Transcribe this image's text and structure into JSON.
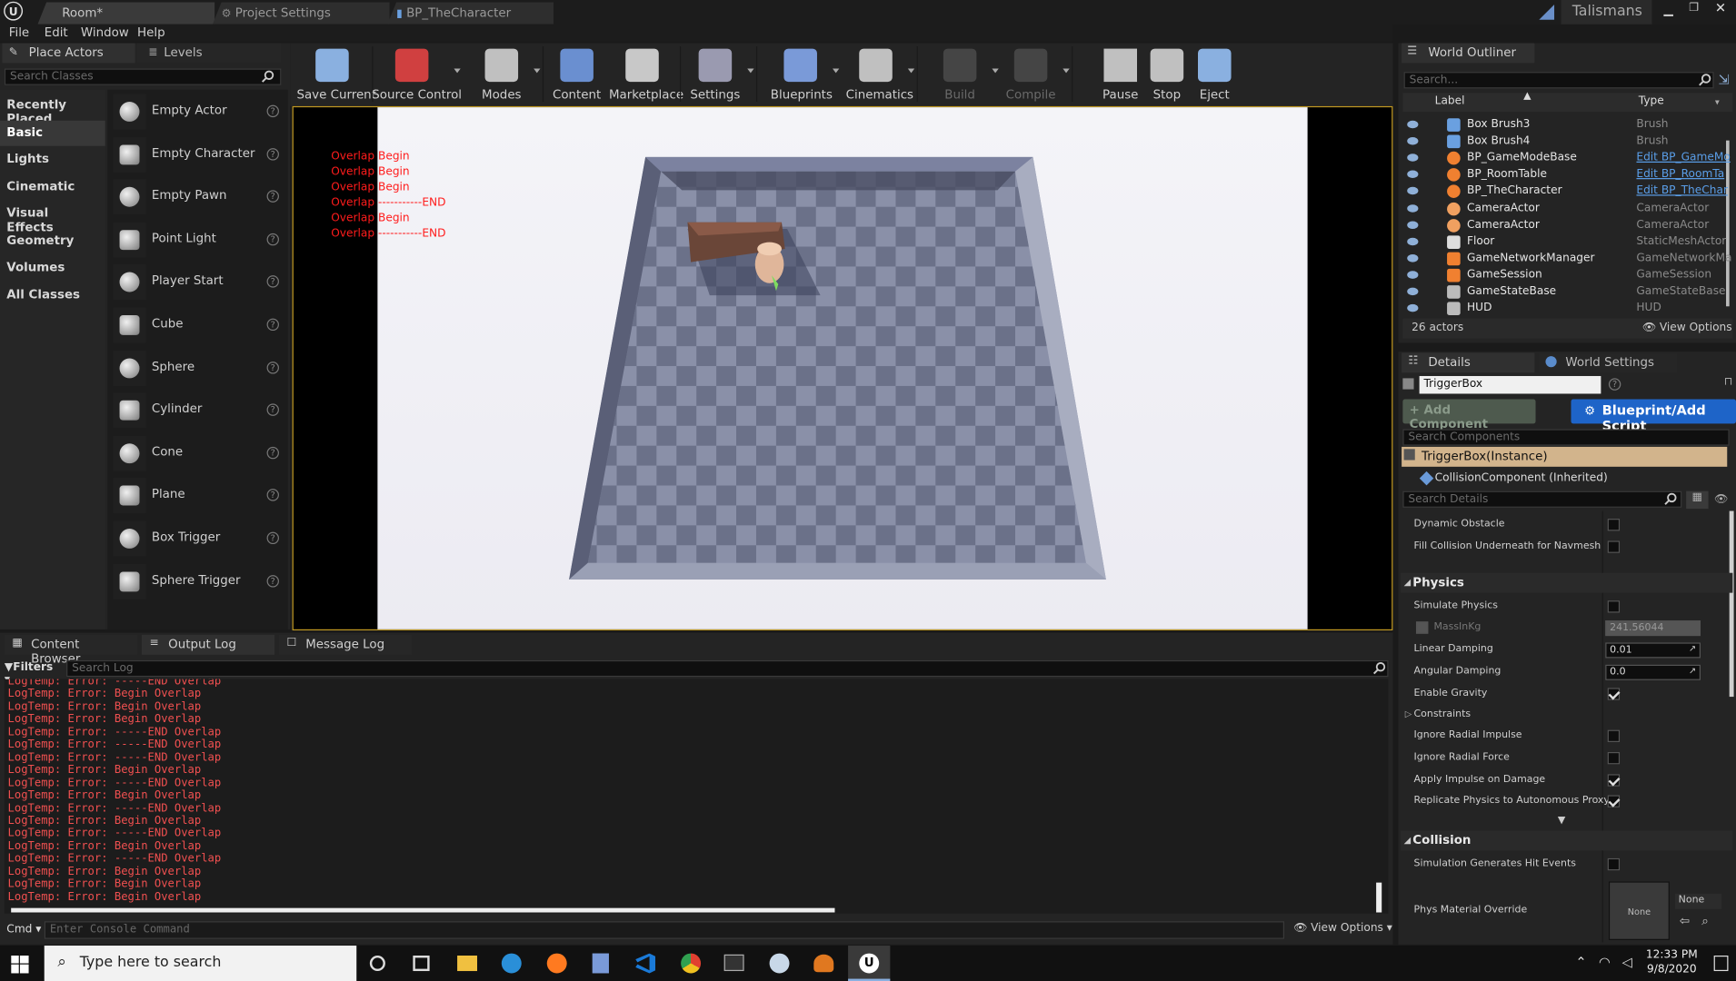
{
  "title_bar": {
    "tabs": [
      "Room*",
      "Project Settings",
      "BP_TheCharacter"
    ],
    "project_name": "Talismans"
  },
  "menu": [
    "File",
    "Edit",
    "Window",
    "Help"
  ],
  "place_actors": {
    "tab_label": "Place Actors",
    "levels_tab": "Levels",
    "search_placeholder": "Search Classes",
    "categories": [
      "Recently Placed",
      "Basic",
      "Lights",
      "Cinematic",
      "Visual Effects",
      "Geometry",
      "Volumes",
      "All Classes"
    ],
    "selected_category": "Basic",
    "actors": [
      "Empty Actor",
      "Empty Character",
      "Empty Pawn",
      "Point Light",
      "Player Start",
      "Cube",
      "Sphere",
      "Cylinder",
      "Cone",
      "Plane",
      "Box Trigger",
      "Sphere Trigger"
    ]
  },
  "toolbar": [
    "Save Current",
    "Source Control",
    "Modes",
    "Content",
    "Marketplace",
    "Settings",
    "Blueprints",
    "Cinematics",
    "Build",
    "Compile",
    "Pause",
    "Stop",
    "Eject"
  ],
  "viewport": {
    "overlay_lines": [
      "Overlap Begin",
      "Overlap Begin",
      "Overlap Begin",
      "Overlap -----------END",
      "Overlap Begin",
      "Overlap -----------END"
    ]
  },
  "world_outliner": {
    "title": "World Outliner",
    "search_placeholder": "Search...",
    "col_label": "Label",
    "col_type": "Type",
    "rows": [
      {
        "label": "Box Brush3",
        "type": "Brush",
        "link": false
      },
      {
        "label": "Box Brush4",
        "type": "Brush",
        "link": false
      },
      {
        "label": "BP_GameModeBase",
        "type": "Edit BP_GameMo",
        "link": true
      },
      {
        "label": "BP_RoomTable",
        "type": "Edit BP_RoomTa",
        "link": true
      },
      {
        "label": "BP_TheCharacter",
        "type": "Edit BP_TheChar",
        "link": true
      },
      {
        "label": "CameraActor",
        "type": "CameraActor",
        "link": false
      },
      {
        "label": "CameraActor",
        "type": "CameraActor",
        "link": false
      },
      {
        "label": "Floor",
        "type": "StaticMeshActor",
        "link": false
      },
      {
        "label": "GameNetworkManager",
        "type": "GameNetworkMar",
        "link": false
      },
      {
        "label": "GameSession",
        "type": "GameSession",
        "link": false
      },
      {
        "label": "GameStateBase",
        "type": "GameStateBase",
        "link": false
      },
      {
        "label": "HUD",
        "type": "HUD",
        "link": false
      }
    ],
    "count": "26 actors",
    "view_options": "View Options"
  },
  "details": {
    "tab": "Details",
    "world_settings_tab": "World Settings",
    "name_value": "TriggerBox",
    "add_component": "+ Add Component",
    "blueprint_button": "Blueprint/Add Script",
    "search_components": "Search Components",
    "instance": "TriggerBox(Instance)",
    "collision_component": "CollisionComponent (Inherited)",
    "search_details": "Search Details",
    "rows_top": [
      {
        "label": "Dynamic Obstacle",
        "checked": false
      },
      {
        "label": "Fill Collision Underneath for Navmesh",
        "checked": false
      }
    ],
    "physics_header": "Physics",
    "simulate_physics": "Simulate Physics",
    "mass_label": "MassInKg",
    "mass_value": "241.56044",
    "linear_damping": "Linear Damping",
    "linear_value": "0.01",
    "angular_damping": "Angular Damping",
    "angular_value": "0.0",
    "enable_gravity": "Enable Gravity",
    "constraints": "Constraints",
    "rows_bottom": [
      {
        "label": "Ignore Radial Impulse",
        "checked": false
      },
      {
        "label": "Ignore Radial Force",
        "checked": false
      },
      {
        "label": "Apply Impulse on Damage",
        "checked": true
      },
      {
        "label": "Replicate Physics to Autonomous Proxy",
        "checked": true
      }
    ],
    "collision_header": "Collision",
    "sim_hit_events": "Simulation Generates Hit Events",
    "phys_material": "Phys Material Override",
    "phys_none": "None",
    "phys_dropdown": "None"
  },
  "bottom_tabs": [
    "Content Browser",
    "Output Log",
    "Message Log"
  ],
  "log": {
    "filters": "Filters",
    "search_placeholder": "Search Log",
    "lines": [
      "LogTemp: Error: -----END Overlap",
      "LogTemp: Error: Begin Overlap",
      "LogTemp: Error: Begin Overlap",
      "LogTemp: Error: Begin Overlap",
      "LogTemp: Error: -----END Overlap",
      "LogTemp: Error: -----END Overlap",
      "LogTemp: Error: -----END Overlap",
      "LogTemp: Error: Begin Overlap",
      "LogTemp: Error: -----END Overlap",
      "LogTemp: Error: Begin Overlap",
      "LogTemp: Error: -----END Overlap",
      "LogTemp: Error: Begin Overlap",
      "LogTemp: Error: -----END Overlap",
      "LogTemp: Error: Begin Overlap",
      "LogTemp: Error: -----END Overlap",
      "LogTemp: Error: Begin Overlap",
      "LogTemp: Error: Begin Overlap",
      "LogTemp: Error: Begin Overlap"
    ],
    "cmd": "Cmd",
    "console_placeholder": "Enter Console Command",
    "view_options": "View Options"
  },
  "taskbar": {
    "search": "Type here to search",
    "time": "12:33 PM",
    "date": "9/8/2020"
  }
}
